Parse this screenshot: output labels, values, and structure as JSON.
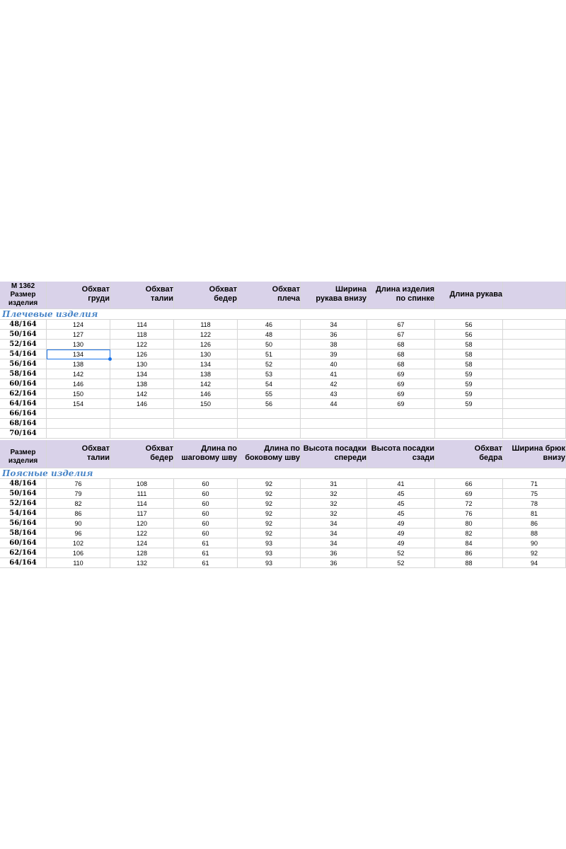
{
  "model": "М 1362",
  "top_table": {
    "first_header": [
      "Размер",
      "изделия"
    ],
    "headers": [
      [
        "Обхват",
        "груди"
      ],
      [
        "Обхват",
        "талии"
      ],
      [
        "Обхват",
        "бедер"
      ],
      [
        "Обхват",
        "плеча"
      ],
      [
        "Ширина",
        "рукава внизу"
      ],
      [
        "Длина изделия",
        "по спинке"
      ],
      [
        "Длина рукава"
      ],
      []
    ],
    "section_label": "Плечевые изделия",
    "rows": [
      {
        "size": "48/164",
        "values": [
          "124",
          "114",
          "118",
          "46",
          "34",
          "67",
          "56",
          ""
        ]
      },
      {
        "size": "50/164",
        "values": [
          "127",
          "118",
          "122",
          "48",
          "36",
          "67",
          "56",
          ""
        ]
      },
      {
        "size": "52/164",
        "values": [
          "130",
          "122",
          "126",
          "50",
          "38",
          "68",
          "58",
          ""
        ]
      },
      {
        "size": "54/164",
        "values": [
          "134",
          "126",
          "130",
          "51",
          "39",
          "68",
          "58",
          ""
        ]
      },
      {
        "size": "56/164",
        "values": [
          "138",
          "130",
          "134",
          "52",
          "40",
          "68",
          "58",
          ""
        ]
      },
      {
        "size": "58/164",
        "values": [
          "142",
          "134",
          "138",
          "53",
          "41",
          "69",
          "59",
          ""
        ]
      },
      {
        "size": "60/164",
        "values": [
          "146",
          "138",
          "142",
          "54",
          "42",
          "69",
          "59",
          ""
        ]
      },
      {
        "size": "62/164",
        "values": [
          "150",
          "142",
          "146",
          "55",
          "43",
          "69",
          "59",
          ""
        ]
      },
      {
        "size": "64/164",
        "values": [
          "154",
          "146",
          "150",
          "56",
          "44",
          "69",
          "59",
          ""
        ]
      },
      {
        "size": "66/164",
        "values": [
          "",
          "",
          "",
          "",
          "",
          "",
          "",
          ""
        ]
      },
      {
        "size": "68/164",
        "values": [
          "",
          "",
          "",
          "",
          "",
          "",
          "",
          ""
        ]
      },
      {
        "size": "70/164",
        "values": [
          "",
          "",
          "",
          "",
          "",
          "",
          "",
          ""
        ]
      }
    ],
    "selected_cell": {
      "row": 3,
      "col": 0
    }
  },
  "bottom_table": {
    "first_header": [
      "Размер",
      "изделия"
    ],
    "headers": [
      [
        "Обхват",
        "талии"
      ],
      [
        "Обхват",
        "бедер"
      ],
      [
        "Длина по",
        "шаговому шву"
      ],
      [
        "Длина по",
        "боковому шву"
      ],
      [
        "Высота посадки",
        "спереди"
      ],
      [
        "Высота посадки",
        "сзади"
      ],
      [
        "Обхват",
        "бедра"
      ],
      [
        "Ширина брюк",
        "внизу"
      ]
    ],
    "section_label": "Поясные изделия",
    "rows": [
      {
        "size": "48/164",
        "values": [
          "76",
          "108",
          "60",
          "92",
          "31",
          "41",
          "66",
          "71"
        ]
      },
      {
        "size": "50/164",
        "values": [
          "79",
          "111",
          "60",
          "92",
          "32",
          "45",
          "69",
          "75"
        ]
      },
      {
        "size": "52/164",
        "values": [
          "82",
          "114",
          "60",
          "92",
          "32",
          "45",
          "72",
          "78"
        ]
      },
      {
        "size": "54/164",
        "values": [
          "86",
          "117",
          "60",
          "92",
          "32",
          "45",
          "76",
          "81"
        ]
      },
      {
        "size": "56/164",
        "values": [
          "90",
          "120",
          "60",
          "92",
          "34",
          "49",
          "80",
          "86"
        ]
      },
      {
        "size": "58/164",
        "values": [
          "96",
          "122",
          "60",
          "92",
          "34",
          "49",
          "82",
          "88"
        ]
      },
      {
        "size": "60/164",
        "values": [
          "102",
          "124",
          "61",
          "93",
          "34",
          "49",
          "84",
          "90"
        ]
      },
      {
        "size": "62/164",
        "values": [
          "106",
          "128",
          "61",
          "93",
          "36",
          "52",
          "86",
          "92"
        ]
      },
      {
        "size": "64/164",
        "values": [
          "110",
          "132",
          "61",
          "93",
          "36",
          "52",
          "88",
          "94"
        ]
      }
    ]
  },
  "colors": {
    "header_bg": "#d9d2e9",
    "section_text": "#4a86c8",
    "selection": "#1a73e8",
    "grid": "#d6d6d6"
  }
}
